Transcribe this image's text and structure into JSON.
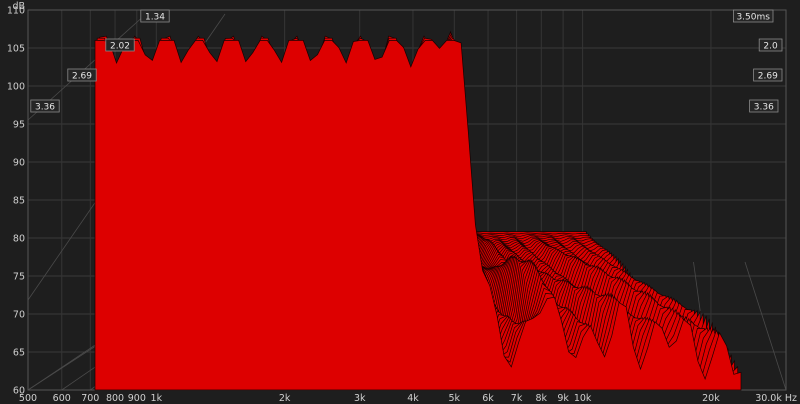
{
  "chart_data": {
    "type": "waterfall-3d",
    "y_axis": {
      "unit_label": "dB",
      "min": 60,
      "max": 110,
      "ticks": [
        60,
        65,
        70,
        75,
        80,
        85,
        90,
        95,
        100,
        105,
        110
      ],
      "grid": true
    },
    "x_axis": {
      "scale": "log",
      "min": 500,
      "max": 30000,
      "ticks": [
        {
          "value": 500,
          "label": "500"
        },
        {
          "value": 600,
          "label": "600"
        },
        {
          "value": 700,
          "label": "700"
        },
        {
          "value": 800,
          "label": "800"
        },
        {
          "value": 900,
          "label": "900"
        },
        {
          "value": 1000,
          "label": "1k"
        },
        {
          "value": 2000,
          "label": "2k"
        },
        {
          "value": 3000,
          "label": "3k"
        },
        {
          "value": 4000,
          "label": "4k"
        },
        {
          "value": 5000,
          "label": "5k"
        },
        {
          "value": 6000,
          "label": "6k"
        },
        {
          "value": 7000,
          "label": "7k"
        },
        {
          "value": 8000,
          "label": "8k"
        },
        {
          "value": 9000,
          "label": "9k"
        },
        {
          "value": 10000,
          "label": "10k"
        },
        {
          "value": 20000,
          "label": "20k"
        },
        {
          "value": 30000,
          "label": "30.0k Hz"
        }
      ],
      "grid": true
    },
    "time_axis": {
      "unit": "ms",
      "max": 3.5,
      "left_labels": [
        "1.34",
        "2.02",
        "2.69",
        "3.36"
      ],
      "right_labels": [
        "3.50ms",
        "2.0",
        "2.69",
        "3.36"
      ]
    },
    "slice_count": 60,
    "fill_color": "#dd0000",
    "edge_color": "#1a0000"
  }
}
